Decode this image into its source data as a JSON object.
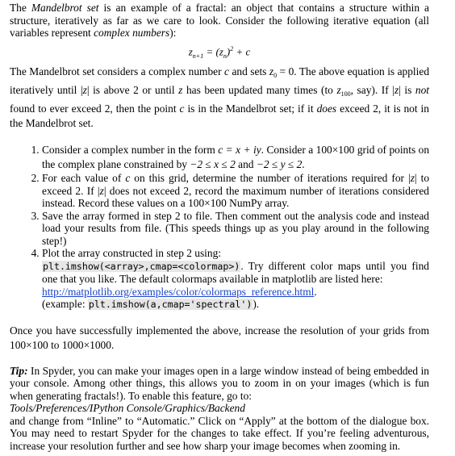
{
  "intro": {
    "p1_a": "The ",
    "p1_term": "Mandelbrot set",
    "p1_b": " is an example of a fractal: an object that contains a structure within a structure, iteratively as far as we care to look. Consider the following iterative equation (all variables represent ",
    "p1_em": "complex numbers",
    "p1_c": "):"
  },
  "equation": {
    "lhs": "z",
    "lhs_sub": "n+1",
    "eq": " = (z",
    "rhs_sub": "n",
    "rhs_close": ")",
    "sup": "2",
    "tail": " + c"
  },
  "para2": {
    "a": "The Mandelbrot set considers a complex number ",
    "c1": "c",
    "b": " and sets ",
    "z0": "z",
    "z0_sub": "0",
    "c": " = 0. The above equation is applied iteratively until |",
    "z1": "z",
    "d": "| is above 2 or until ",
    "z2": "z",
    "e": " has been updated many times (to ",
    "z100": "z",
    "z100_sub": "100",
    "f": ", say). If |",
    "z3": "z",
    "g": "| is ",
    "not": "not",
    "h": " found to ever exceed 2, then the point ",
    "c2": "c",
    "i": " is in the Mandelbrot set; if it ",
    "does": "does",
    "j": " exceed 2, it is not in the Mandelbrot set."
  },
  "steps": [
    {
      "a": "Consider a complex number in the form ",
      "m1": "c = x + iy",
      "b": ". Consider a 100×100 grid of points on the complex plane constrained by ",
      "m2": "−2 ≤ x ≤ 2",
      "c": " and ",
      "m3": "−2 ≤ y ≤ 2",
      "d": "."
    },
    {
      "a": "For each value of ",
      "m1": "c",
      "b": " on this grid, determine the number of iterations required for |",
      "m2": "z",
      "c": "| to exceed 2. If |",
      "m3": "z",
      "d": "| does not exceed 2, record the maximum number of iterations considered instead. Record these values on a 100×100 NumPy array."
    },
    {
      "text": "Save the array formed in step 2 to file. Then comment out the analysis code and instead load your results from file. (This speeds things up as you play around in the following step!)"
    },
    {
      "a": "Plot the array constructed in step 2 using:",
      "code1": "plt.imshow(<array>,cmap=<colormap>)",
      "b": ". Try different color maps until you find one that you like. The default colormaps available in matplotlib are listed here:",
      "link": "http://matplotlib.org/examples/color/colormaps_reference.html",
      "c": ".",
      "d": "(example: ",
      "code2": "plt.imshow(a,cmap='spectral')",
      "e": ")."
    }
  ],
  "para3": {
    "a": "Once you have successfully implemented the above, increase the resolution of your grids from 100×100 to 1000×1000."
  },
  "tip": {
    "label": "Tip:",
    "a": " In Spyder, you can make your images open in a large window instead of being embedded in your console. Among other things, this allows you to zoom in on your images (which is fun when generating fractals!). To enable this feature, go to:",
    "path": "Tools/Preferences/IPython Console/Graphics/Backend",
    "b": "and change from “Inline” to “Automatic.” Click on “Apply” at the bottom of the dialogue box. You may need to restart Spyder for the changes to take effect. If you’re feeling adventurous, increase your resolution further and see how sharp your image becomes when zooming in."
  },
  "colors": {
    "link": "#1a43c8",
    "code_bg": "#e6e6e6"
  }
}
